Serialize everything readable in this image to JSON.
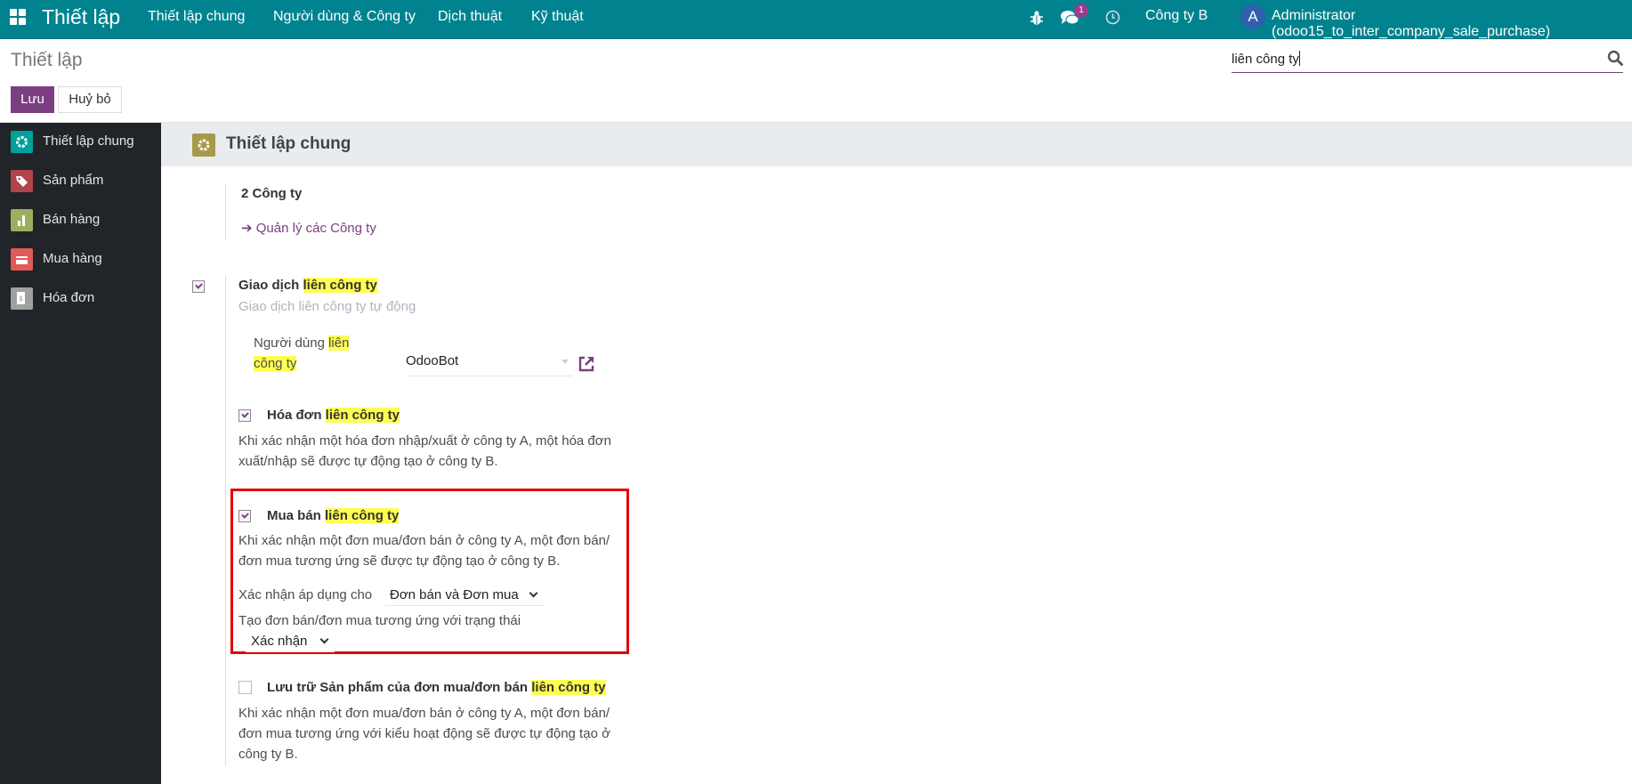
{
  "navbar": {
    "brand": "Thiết lập",
    "menus": [
      "Thiết lập chung",
      "Người dùng & Công ty",
      "Dịch thuật",
      "Kỹ thuật"
    ],
    "icons": [
      "debug-icon",
      "chat-icon",
      "activity-clock-icon"
    ],
    "message_count": "1",
    "company": "Công ty B",
    "avatar_initial": "A",
    "user": "Administrator (odoo15_to_inter_company_sale_purchase)",
    "color": "#00838f"
  },
  "control": {
    "title": "Thiết lập",
    "save_label": "Lưu",
    "discard_label": "Huỷ bỏ",
    "search_value": "liên công ty"
  },
  "sidebar": {
    "items": [
      {
        "label": "Thiết lập chung",
        "icon": "gear-icon",
        "color": "#00a09d"
      },
      {
        "label": "Sản phẩm",
        "icon": "tag-icon",
        "color": "#b0464c"
      },
      {
        "label": "Bán hàng",
        "icon": "sales-chart-icon",
        "color": "#9bb05e"
      },
      {
        "label": "Mua hàng",
        "icon": "purchase-card-icon",
        "color": "#e05a5a"
      },
      {
        "label": "Hóa đơn",
        "icon": "invoice-icon",
        "color": "#a0a0a0"
      }
    ]
  },
  "section": {
    "title": "Thiết lập chung",
    "companies_count": "2 Công ty",
    "manage_companies_link": "Quản lý các Công ty",
    "inter_company": {
      "title_prefix": "Giao dịch ",
      "title_highlight": "liên công ty",
      "checked": true,
      "description": "Giao dịch liên công ty tự động",
      "user_label_prefix": "Người dùng ",
      "user_label_hl1": "liên",
      "user_label_hl2": "công ty",
      "user_value": "OdooBot"
    },
    "invoice": {
      "title_prefix": "Hóa đơn ",
      "title_highlight": "liên công ty",
      "checked": true,
      "desc_line1": "Khi xác nhận một hóa đơn nhập/xuất ở công ty A, một hóa đơn",
      "desc_line2": "xuất/nhập sẽ được tự động tạo ở công ty B."
    },
    "sale_purchase": {
      "title_prefix": "Mua bán ",
      "title_highlight": "liên công ty",
      "checked": true,
      "desc_line1": "Khi xác nhận một đơn mua/đơn bán ở công ty A, một đơn bán/",
      "desc_line2": "đơn mua tương ứng sẽ được tự động tạo ở công ty B.",
      "apply_label": "Xác nhận áp dụng cho",
      "apply_value": "Đơn bán và Đơn mua",
      "state_label": "Tạo đơn bán/đơn mua tương ứng với trạng thái",
      "state_value": "Xác nhận",
      "highlight_box_color": "#e00000"
    },
    "store_products": {
      "title_prefix": "Lưu trữ Sản phẩm của đơn mua/đơn bán ",
      "title_highlight": "liên công ty",
      "checked": false,
      "desc_line1": "Khi xác nhận một đơn mua/đơn bán ở công ty A, một đơn bán/",
      "desc_line2": "đơn mua tương ứng với kiểu hoạt động sẽ được tự động tạo ở",
      "desc_line3": "công ty B."
    }
  }
}
